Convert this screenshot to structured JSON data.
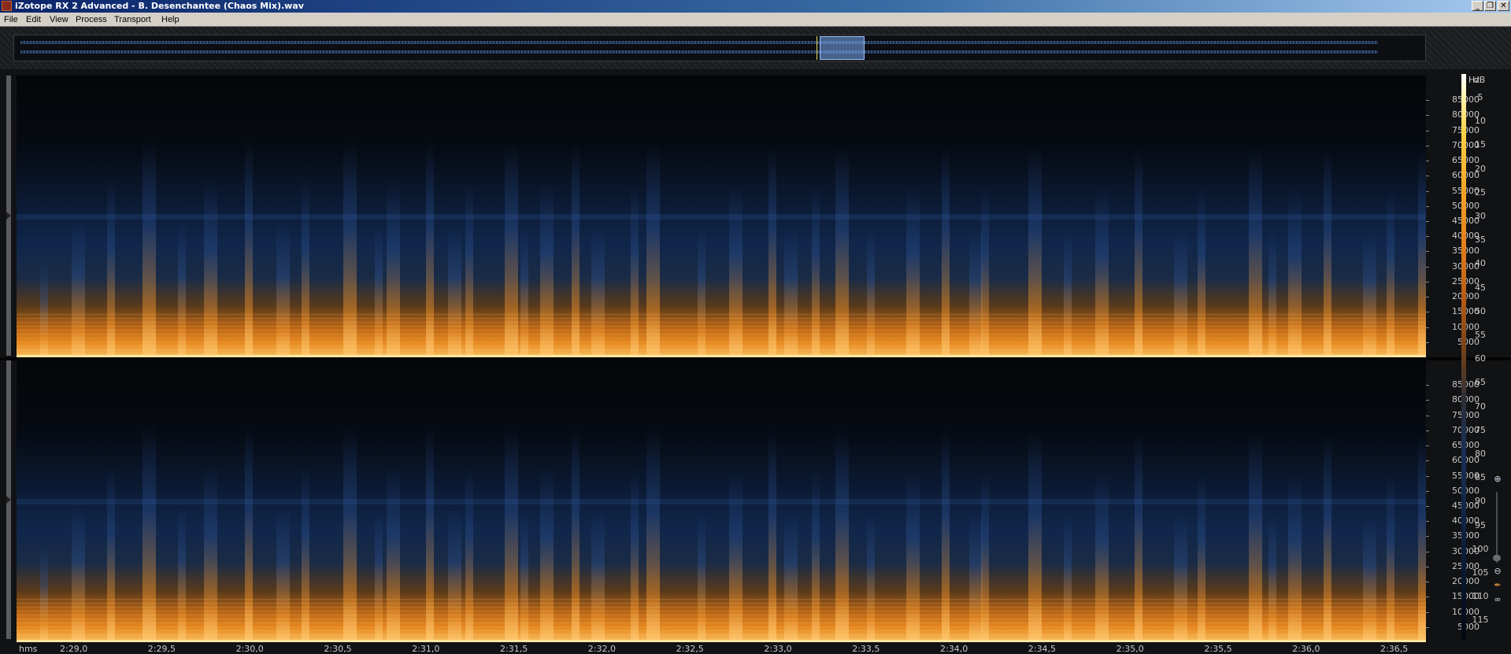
{
  "window": {
    "title": "iZotope RX 2 Advanced - B. Desenchantee (Chaos Mix).wav",
    "controls": {
      "minimize": "_",
      "restore": "❐",
      "close": "✕"
    }
  },
  "menu": [
    "File",
    "Edit",
    "View",
    "Process",
    "Transport",
    "Help"
  ],
  "frequency_axis": {
    "unit": "Hz",
    "labels": [
      "85000",
      "80000",
      "75000",
      "70000",
      "65000",
      "60000",
      "55000",
      "50000",
      "45000",
      "40000",
      "35000",
      "30000",
      "25000",
      "20000",
      "15000",
      "10000",
      "5000"
    ]
  },
  "db_scale": {
    "unit": "dB",
    "labels": [
      "5",
      "10",
      "15",
      "20",
      "25",
      "30",
      "35",
      "40",
      "45",
      "50",
      "55",
      "60",
      "65",
      "70",
      "75",
      "80",
      "85",
      "90",
      "95",
      "100",
      "105",
      "110",
      "115"
    ]
  },
  "time_axis": {
    "unit": "hms",
    "labels": [
      "2:29,0",
      "2:29,5",
      "2:30,0",
      "2:30,5",
      "2:31,0",
      "2:31,5",
      "2:32,0",
      "2:32,5",
      "2:33,0",
      "2:33,5",
      "2:34,0",
      "2:34,5",
      "2:35,0",
      "2:35,5",
      "2:36,0",
      "2:36,5"
    ]
  },
  "colors": {
    "spectrogram_high": "#f7c060",
    "spectrogram_mid": "#e88a20",
    "spectrogram_low": "#10264a",
    "overview_selection": "#78aaf0"
  },
  "icons": {
    "zoom_in": "magnifier-plus-icon",
    "zoom_out": "magnifier-minus-icon"
  }
}
